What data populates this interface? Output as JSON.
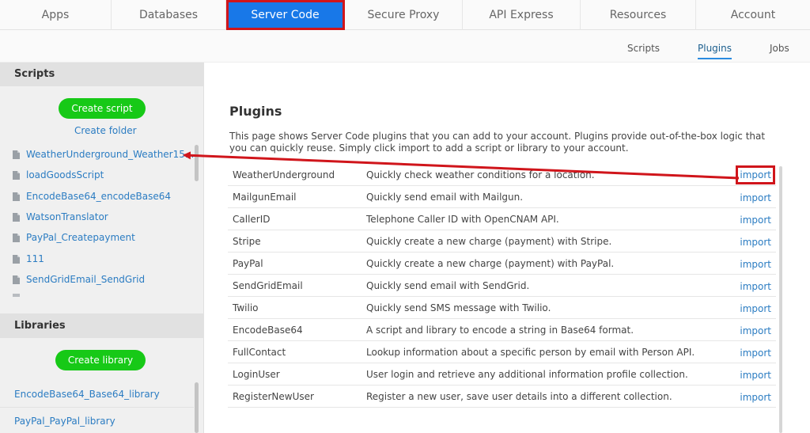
{
  "topnav": {
    "items": [
      {
        "label": "Apps"
      },
      {
        "label": "Databases"
      },
      {
        "label": "Server Code",
        "active": true
      },
      {
        "label": "Secure Proxy"
      },
      {
        "label": "API Express"
      },
      {
        "label": "Resources"
      },
      {
        "label": "Account"
      }
    ]
  },
  "subnav": {
    "items": [
      {
        "label": "Scripts"
      },
      {
        "label": "Plugins",
        "active": true
      },
      {
        "label": "Jobs"
      }
    ]
  },
  "sidebar": {
    "scripts_header": "Scripts",
    "create_script_label": "Create script",
    "create_folder_label": "Create folder",
    "scripts": [
      "WeatherUnderground_Weather15...",
      "loadGoodsScript",
      "EncodeBase64_encodeBase64",
      "WatsonTranslator",
      "PayPal_Createpayment",
      "111",
      "SendGridEmail_SendGrid"
    ],
    "libraries_header": "Libraries",
    "create_library_label": "Create library",
    "libraries": [
      "EncodeBase64_Base64_library",
      "PayPal_PayPal_library"
    ]
  },
  "main": {
    "title": "Plugins",
    "description": "This page shows Server Code plugins that you can add to your account. Plugins provide out-of-the-box logic that you can quickly reuse. Simply click import to add a script or library to your account.",
    "import_label": "import",
    "plugins": [
      {
        "name": "WeatherUnderground",
        "description": "Quickly check weather conditions for a location.",
        "highlighted": true
      },
      {
        "name": "MailgunEmail",
        "description": "Quickly send email with Mailgun."
      },
      {
        "name": "CallerID",
        "description": "Telephone Caller ID with OpenCNAM API."
      },
      {
        "name": "Stripe",
        "description": "Quickly create a new charge (payment) with Stripe."
      },
      {
        "name": "PayPal",
        "description": "Quickly create a new charge (payment) with PayPal."
      },
      {
        "name": "SendGridEmail",
        "description": "Quickly send email with SendGrid."
      },
      {
        "name": "Twilio",
        "description": "Quickly send SMS message with Twilio."
      },
      {
        "name": "EncodeBase64",
        "description": "A script and library to encode a string in Base64 format."
      },
      {
        "name": "FullContact",
        "description": "Lookup information about a specific person by email with Person API."
      },
      {
        "name": "LoginUser",
        "description": "User login and retrieve any additional information profile collection."
      },
      {
        "name": "RegisterNewUser",
        "description": "Register a new user, save user details into a different collection."
      }
    ]
  },
  "colors": {
    "accent": "#1878e8",
    "highlight": "#d0151b",
    "button_green": "#17c917",
    "link": "#2b7cc2"
  }
}
